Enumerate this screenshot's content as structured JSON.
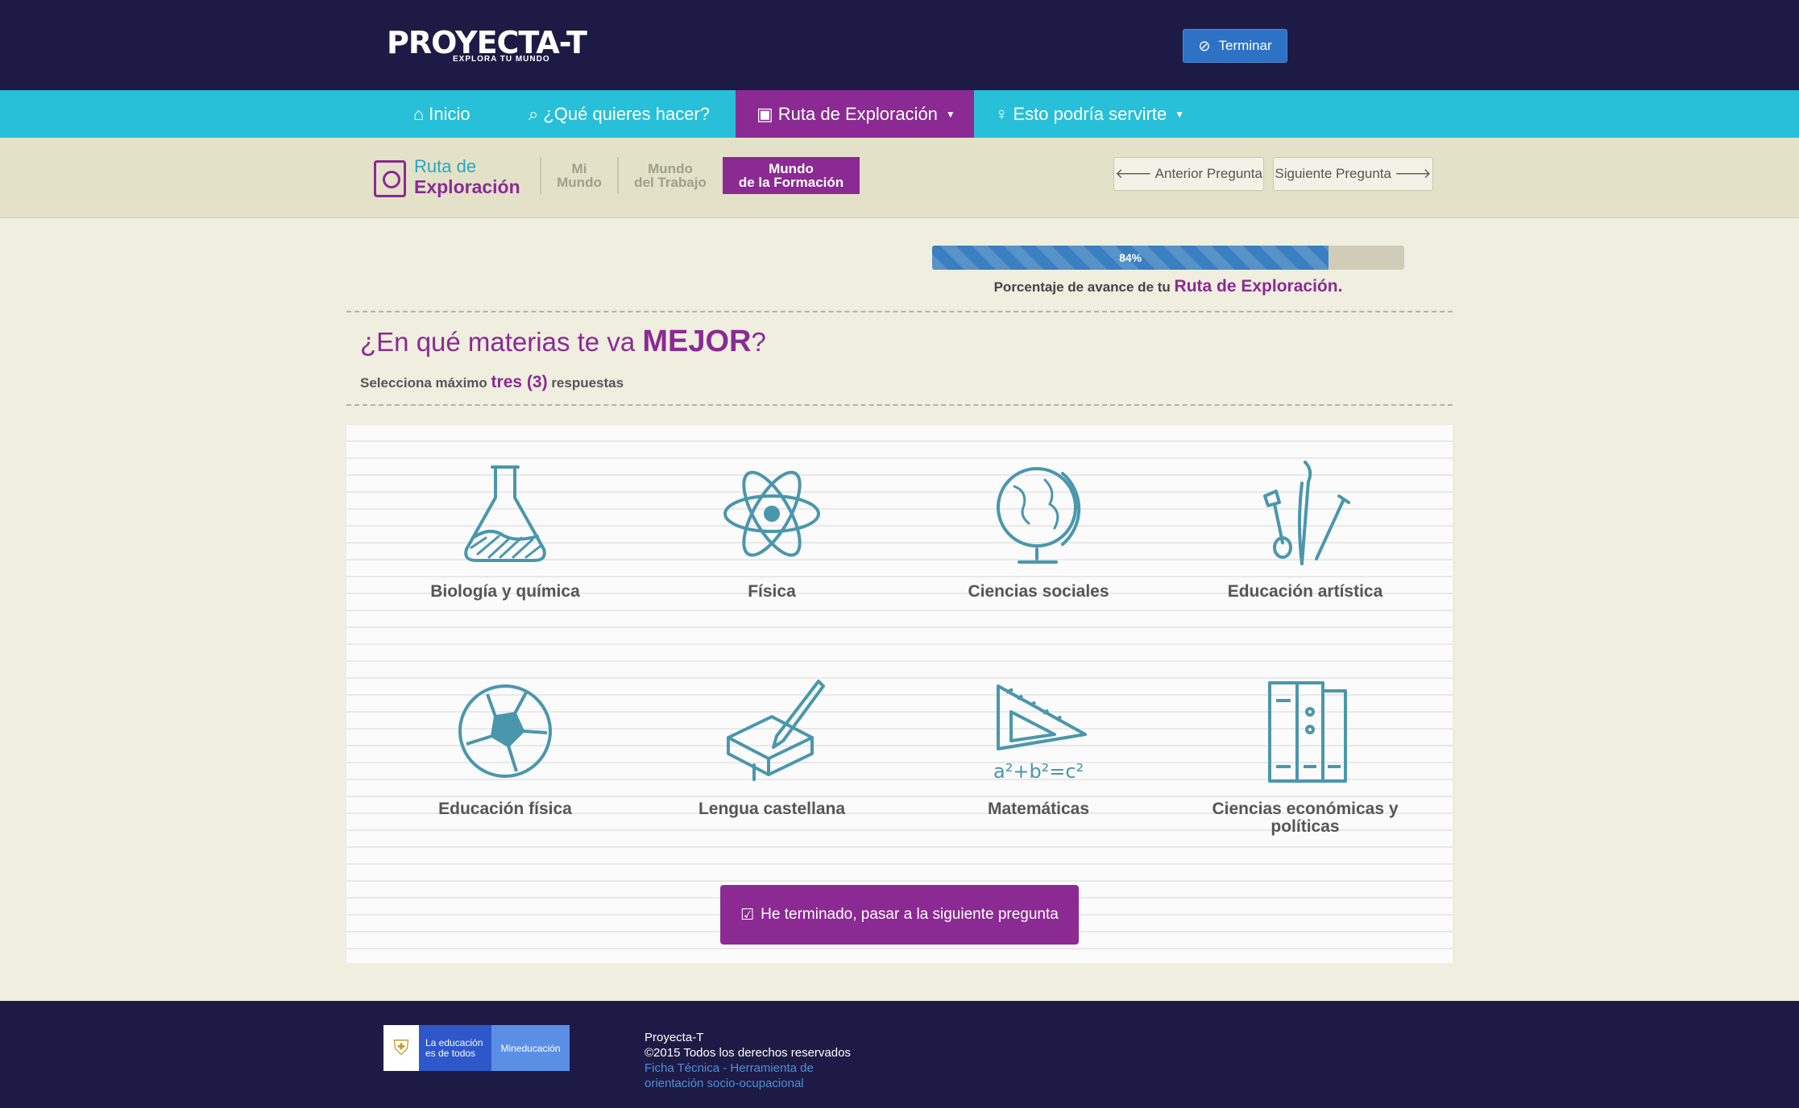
{
  "header": {
    "logo_text": "PROYECTA-T",
    "logo_tagline": "EXPLORA TU MUNDO",
    "end_button": "Terminar"
  },
  "nav": {
    "items": [
      {
        "label": "Inicio",
        "icon": "home-icon"
      },
      {
        "label": "¿Qué quieres hacer?",
        "icon": "search-icon"
      },
      {
        "label": "Ruta de Exploración",
        "icon": "document-search-icon",
        "active": true,
        "dropdown": true
      },
      {
        "label": "Esto podría servirte",
        "icon": "lightbulb-icon",
        "dropdown": true
      }
    ]
  },
  "subnav": {
    "brand_line1": "Ruta de",
    "brand_line2": "Exploración",
    "steps": [
      {
        "line1": "Mi",
        "line2": "Mundo"
      },
      {
        "line1": "Mundo",
        "line2": "del Trabajo"
      },
      {
        "line1": "Mundo",
        "line2": "de la Formación",
        "active": true
      }
    ],
    "prev_label": "Anterior Pregunta",
    "next_label": "Siguiente Pregunta"
  },
  "progress": {
    "value": 84,
    "label": "84%",
    "caption_prefix": "Porcentaje de avance de tu",
    "caption_highlight": "Ruta de Exploración."
  },
  "question": {
    "prefix": "¿En qué materias te va",
    "emphasis": "MEJOR",
    "suffix": "?",
    "instruction_prefix": "Selecciona máximo",
    "instruction_highlight": "tres (3)",
    "instruction_suffix": "respuestas"
  },
  "subjects": [
    {
      "label": "Biología y química",
      "icon": "flask-icon"
    },
    {
      "label": "Física",
      "icon": "atom-icon"
    },
    {
      "label": "Ciencias sociales",
      "icon": "globe-icon"
    },
    {
      "label": "Educación artística",
      "icon": "paintbrush-icon"
    },
    {
      "label": "Educación física",
      "icon": "soccer-ball-icon"
    },
    {
      "label": "Lengua castellana",
      "icon": "book-pen-icon"
    },
    {
      "label": "Matemáticas",
      "icon": "triangle-ruler-icon"
    },
    {
      "label": "Ciencias económicas y políticas",
      "icon": "binders-icon"
    }
  ],
  "finish_button": "He terminado, pasar a la siguiente pregunta",
  "footer": {
    "gov_line1": "La educación",
    "gov_line2": "es de todos",
    "ministry": "Mineducación",
    "site_name": "Proyecta-T",
    "copyright": "©2015 Todos los derechos reservados",
    "link_line1": "Ficha Técnica - Herramienta de",
    "link_line2": "orientación socio-ocupacional"
  },
  "colors": {
    "navy": "#1d1b45",
    "cyan": "#27c0d8",
    "purple": "#8b2a93",
    "blue": "#2d72c5",
    "icon_teal": "#4a97ad"
  }
}
